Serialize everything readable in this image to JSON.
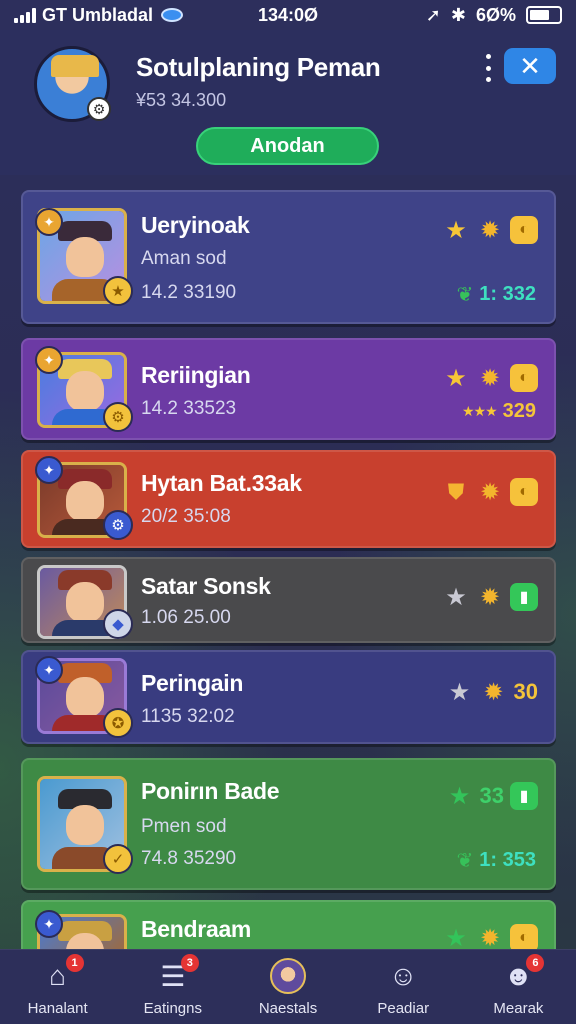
{
  "status_bar": {
    "carrier": "GT Umbladal",
    "time": "134:0Ø",
    "battery": "6Ø%"
  },
  "header": {
    "title": "Sotulplaning Peman",
    "subtitle": "¥53 34.300",
    "action_label": "Anodan"
  },
  "list": [
    {
      "title": "Ueryinoak",
      "line1": "Aman sod",
      "line2": "14.2 33190",
      "metric": "1: 332",
      "metric_color": "teal",
      "icons": [
        "star",
        "gear-icon",
        "coin"
      ]
    },
    {
      "title": "Reriingian",
      "line1": "",
      "line2": "14.2 33523",
      "metric": "329",
      "metric_color": "gold",
      "icons": [
        "star",
        "gear-icon",
        "coin"
      ]
    },
    {
      "title": "Hytan Bat.33ak",
      "line1": "",
      "line2": "20/2 35:08",
      "metric": "",
      "metric_color": "",
      "icons": [
        "shield",
        "gear-icon",
        "coin"
      ]
    },
    {
      "title": "Satar Sonsk",
      "line1": "",
      "line2": "1.06 25.00",
      "metric": "",
      "metric_color": "",
      "icons": [
        "star-gray",
        "gear-icon",
        "coin-green"
      ]
    },
    {
      "title": "Peringain",
      "line1": "",
      "line2": "1135 32:02",
      "metric": "30",
      "metric_color": "gold",
      "icons": [
        "star-gray",
        "gear-icon"
      ]
    },
    {
      "title": "Ponirın Bade",
      "line1": "Pmen sod",
      "line2": "74.8 35290",
      "metric": "1: 353",
      "metric_color": "teal",
      "top_metric": "33",
      "icons": [
        "star-green",
        "coin-green"
      ]
    },
    {
      "title": "Bendraam",
      "line1": "",
      "line2": "",
      "metric": "",
      "metric_color": "",
      "icons": [
        "star-green",
        "gear-icon",
        "coin"
      ]
    }
  ],
  "bottom_nav": [
    {
      "label": "Hanalant",
      "icon": "home-icon",
      "badge": "1"
    },
    {
      "label": "Eatingns",
      "icon": "list-icon",
      "badge": "3"
    },
    {
      "label": "Naestals",
      "icon": "avatar-icon",
      "badge": ""
    },
    {
      "label": "Peadiar",
      "icon": "profile-icon",
      "badge": ""
    },
    {
      "label": "Mearak",
      "icon": "profile-alert-icon",
      "badge": "6"
    }
  ],
  "colors": {
    "accent_green": "#1fad5a",
    "close_blue": "#2f86e6",
    "card_blue": "#3f4388",
    "card_purple": "#6c3aa4",
    "card_red": "#c8402e",
    "card_gray": "#4a4a4c",
    "card_green": "#3e8a45"
  }
}
